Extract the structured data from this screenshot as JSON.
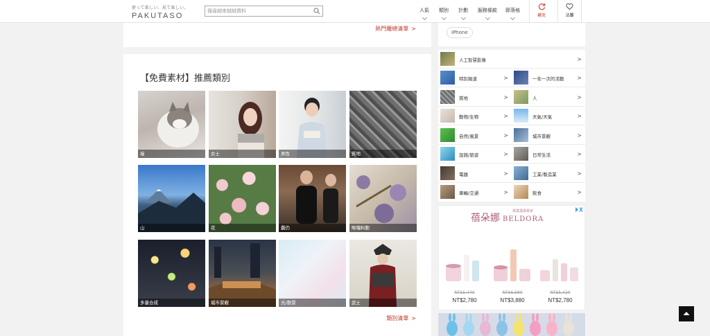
{
  "header": {
    "logo_tagline": "使って楽しい、見て楽しい。",
    "logo_word": "PAKUTASO",
    "search_placeholder": "搜尋越來越越資料",
    "nav": [
      "人氣",
      "類別",
      "計劃",
      "服務條款",
      "節落格"
    ],
    "refresh_label": "補充",
    "like_label": "法攤"
  },
  "top_card": {
    "more_link": "熱門羅總清單",
    "arrow": ">"
  },
  "section": {
    "title": "【免費素材】推薦類別",
    "tiles": [
      "貓",
      "女士",
      "男性",
      "質地",
      "山",
      "花",
      "蠢仍",
      "喉嚨料動",
      "多量合成",
      "城市景觀",
      "光/散景",
      "武士"
    ],
    "more_link": "類別清單",
    "arrow": ">"
  },
  "sidebar": {
    "tag": "iPhone",
    "categories": [
      "人工智慧影像",
      "特別報道",
      "一年一次的活動",
      "質地",
      "人",
      "動物/生物",
      "天氣/天氣",
      "自然/風景",
      "城市景觀",
      "設施/旅遊",
      "日常生活",
      "電器",
      "工業/製造業",
      "車輛/交通",
      "飲食"
    ],
    "arrow": ">"
  },
  "ad": {
    "brand_cjk": "蓓朵娜",
    "brand_latin": "BELDORA",
    "brand_sub": "專業護膚專家",
    "products": [
      {
        "old": "NT$5,440",
        "price": "NT$2,780"
      },
      {
        "old": "NT$6,580",
        "price": "NT$3,880"
      },
      {
        "old": "NT$5,420",
        "price": "NT$2,780"
      }
    ]
  },
  "colors": {
    "accent": "#c0392b",
    "caption_bg": "#4d4d4d",
    "page_bg": "#f2f2f2"
  },
  "icons": [
    "search-icon",
    "refresh-icon",
    "heart-icon",
    "chevron-right-icon",
    "ad-close-icon",
    "arrow-up-icon"
  ]
}
